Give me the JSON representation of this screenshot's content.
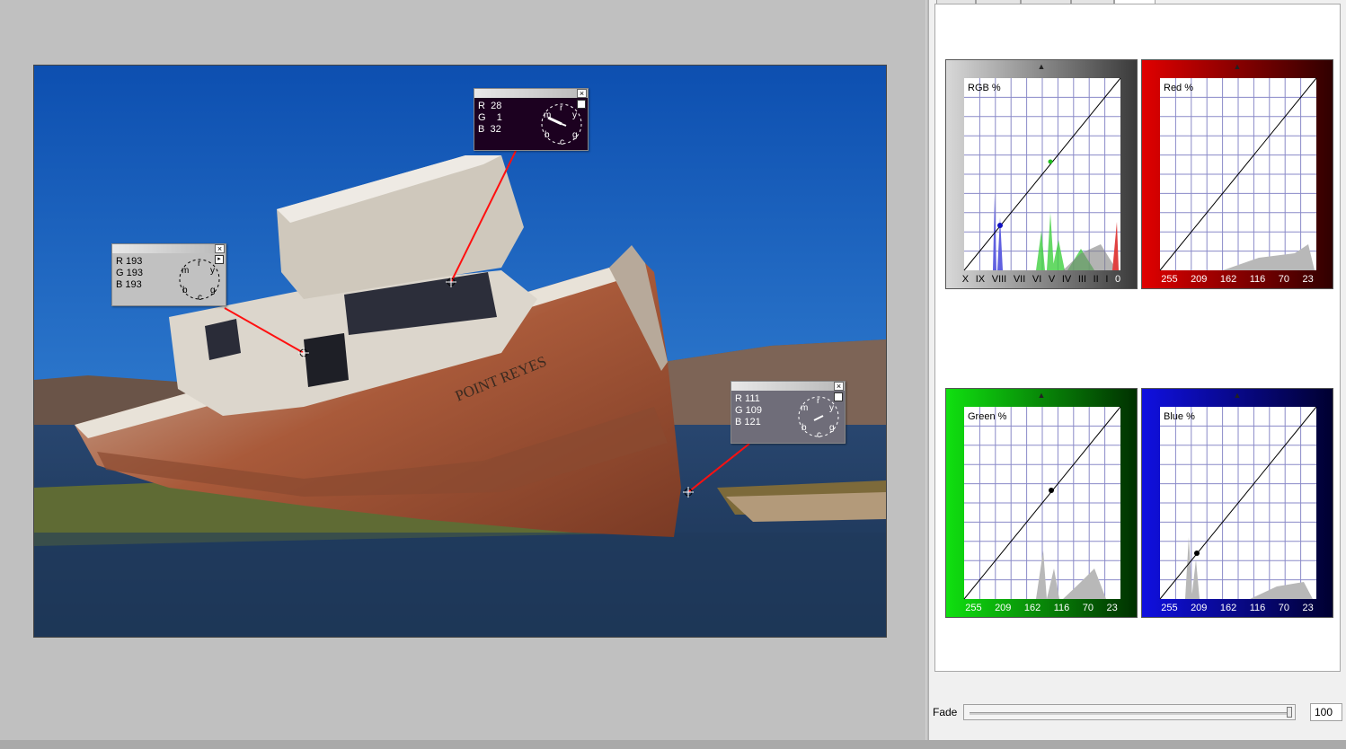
{
  "probes": [
    {
      "id": "light",
      "r": "193",
      "g": "193",
      "b": "193",
      "r_label": "R",
      "g_label": "G",
      "b_label": "B",
      "bg": "#c1c1c1",
      "text": "#000000"
    },
    {
      "id": "dark",
      "r": "28",
      "g": "1",
      "b": "32",
      "r_label": "R",
      "g_label": "G",
      "b_label": "B",
      "bg": "#1c0120",
      "text": "#ffffff"
    },
    {
      "id": "mid",
      "r": "111",
      "g": "109",
      "b": "121",
      "r_label": "R",
      "g_label": "G",
      "b_label": "B",
      "bg": "#6f6d79",
      "text": "#ffffff"
    }
  ],
  "wheel_letters": {
    "r": "r",
    "y": "y",
    "g": "g",
    "c": "c",
    "b": "b",
    "m": "m"
  },
  "close_glyph": "×",
  "menu_glyph": "▸",
  "photo": {
    "boat_name": "POINT REYES"
  },
  "curves": {
    "rgb": {
      "label": "RGB %",
      "axis": [
        "X",
        "IX",
        "VIII",
        "VII",
        "VI",
        "V",
        "IV",
        "III",
        "II",
        "I",
        "0"
      ],
      "accent": "#808080"
    },
    "red": {
      "label": "Red %",
      "axis": [
        "255",
        "209",
        "162",
        "116",
        "70",
        "23"
      ],
      "accent": "#c00000"
    },
    "green": {
      "label": "Green %",
      "axis": [
        "255",
        "209",
        "162",
        "116",
        "70",
        "23"
      ],
      "accent": "#10a010"
    },
    "blue": {
      "label": "Blue %",
      "axis": [
        "255",
        "209",
        "162",
        "116",
        "70",
        "23"
      ],
      "accent": "#1010a0"
    }
  },
  "fade": {
    "label": "Fade",
    "value": "100",
    "fraction": 1.0
  }
}
